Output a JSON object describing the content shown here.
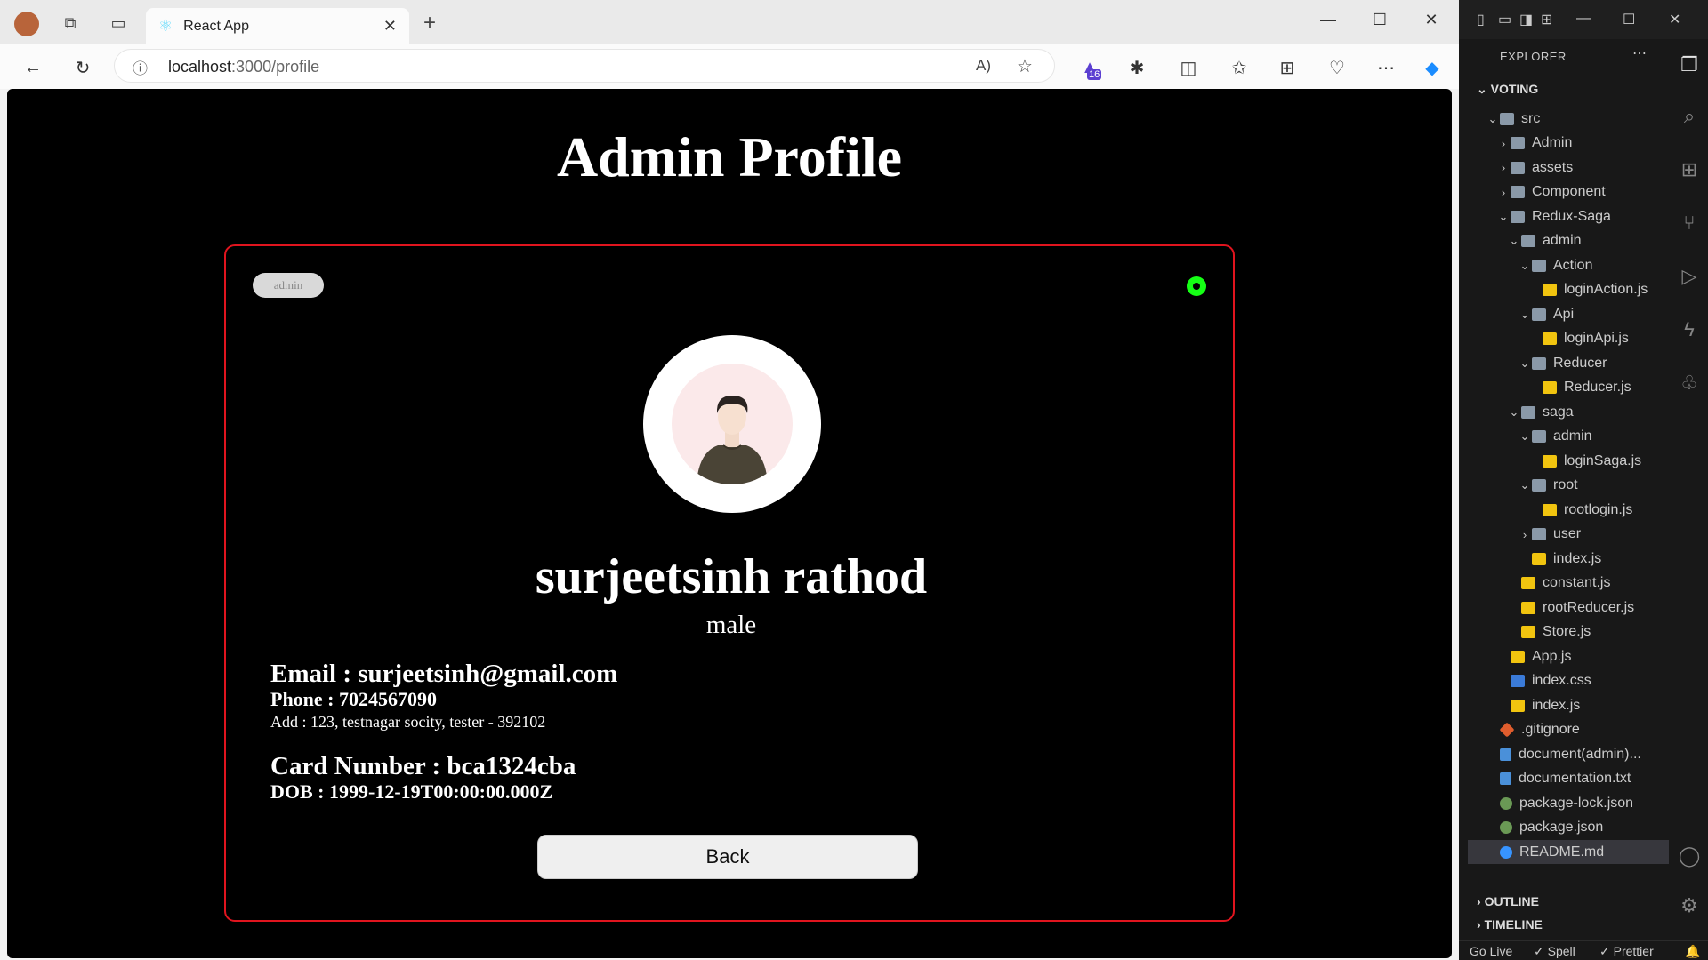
{
  "browser": {
    "tab_title": "React App",
    "url_host": "localhost",
    "url_rest": ":3000/profile",
    "ext_badge": "16"
  },
  "page": {
    "title": "Admin Profile",
    "role_badge": "admin",
    "name": "surjeetsinh rathod",
    "gender": "male",
    "email_line": "Email : surjeetsinh@gmail.com",
    "phone_line": "Phone : 7024567090",
    "address_line": "Add : 123, testnagar socity, tester - 392102",
    "card_line": "Card Number : bca1324cba",
    "dob_line": "DOB : 1999-12-19T00:00:00.000Z",
    "back_label": "Back"
  },
  "vscode": {
    "explorer_label": "EXPLORER",
    "project": "VOTING",
    "tree": [
      {
        "label": "src",
        "depth": 1,
        "chev": "v",
        "icon": "folder"
      },
      {
        "label": "Admin",
        "depth": 2,
        "chev": ">",
        "icon": "folder"
      },
      {
        "label": "assets",
        "depth": 2,
        "chev": ">",
        "icon": "folder"
      },
      {
        "label": "Component",
        "depth": 2,
        "chev": ">",
        "icon": "folder"
      },
      {
        "label": "Redux-Saga",
        "depth": 2,
        "chev": "v",
        "icon": "folder"
      },
      {
        "label": "admin",
        "depth": 3,
        "chev": "v",
        "icon": "folder"
      },
      {
        "label": "Action",
        "depth": 4,
        "chev": "v",
        "icon": "folder"
      },
      {
        "label": "loginAction.js",
        "depth": 5,
        "chev": "",
        "icon": "js"
      },
      {
        "label": "Api",
        "depth": 4,
        "chev": "v",
        "icon": "folder"
      },
      {
        "label": "loginApi.js",
        "depth": 5,
        "chev": "",
        "icon": "js"
      },
      {
        "label": "Reducer",
        "depth": 4,
        "chev": "v",
        "icon": "folder"
      },
      {
        "label": "Reducer.js",
        "depth": 5,
        "chev": "",
        "icon": "js"
      },
      {
        "label": "saga",
        "depth": 3,
        "chev": "v",
        "icon": "folder"
      },
      {
        "label": "admin",
        "depth": 4,
        "chev": "v",
        "icon": "folder"
      },
      {
        "label": "loginSaga.js",
        "depth": 5,
        "chev": "",
        "icon": "js"
      },
      {
        "label": "root",
        "depth": 4,
        "chev": "v",
        "icon": "folder"
      },
      {
        "label": "rootlogin.js",
        "depth": 5,
        "chev": "",
        "icon": "js"
      },
      {
        "label": "user",
        "depth": 4,
        "chev": ">",
        "icon": "folder"
      },
      {
        "label": "index.js",
        "depth": 4,
        "chev": "",
        "icon": "js"
      },
      {
        "label": "constant.js",
        "depth": 3,
        "chev": "",
        "icon": "js"
      },
      {
        "label": "rootReducer.js",
        "depth": 3,
        "chev": "",
        "icon": "js"
      },
      {
        "label": "Store.js",
        "depth": 3,
        "chev": "",
        "icon": "js"
      },
      {
        "label": "App.js",
        "depth": 2,
        "chev": "",
        "icon": "js"
      },
      {
        "label": "index.css",
        "depth": 2,
        "chev": "",
        "icon": "css"
      },
      {
        "label": "index.js",
        "depth": 2,
        "chev": "",
        "icon": "js"
      },
      {
        "label": ".gitignore",
        "depth": 1,
        "chev": "",
        "icon": "git"
      },
      {
        "label": "document(admin)...",
        "depth": 1,
        "chev": "",
        "icon": "doc"
      },
      {
        "label": "documentation.txt",
        "depth": 1,
        "chev": "",
        "icon": "doc"
      },
      {
        "label": "package-lock.json",
        "depth": 1,
        "chev": "",
        "icon": "json"
      },
      {
        "label": "package.json",
        "depth": 1,
        "chev": "",
        "icon": "json"
      },
      {
        "label": "README.md",
        "depth": 1,
        "chev": "",
        "icon": "info-i",
        "selected": true
      }
    ],
    "outline_label": "OUTLINE",
    "timeline_label": "TIMELINE",
    "status": {
      "golive": "Go Live",
      "spell": "✓ Spell",
      "prettier": "✓ Prettier"
    }
  },
  "colors": {
    "card_border": "#e0141e",
    "status_dot": "#15ff15",
    "page_bg": "#000000"
  }
}
